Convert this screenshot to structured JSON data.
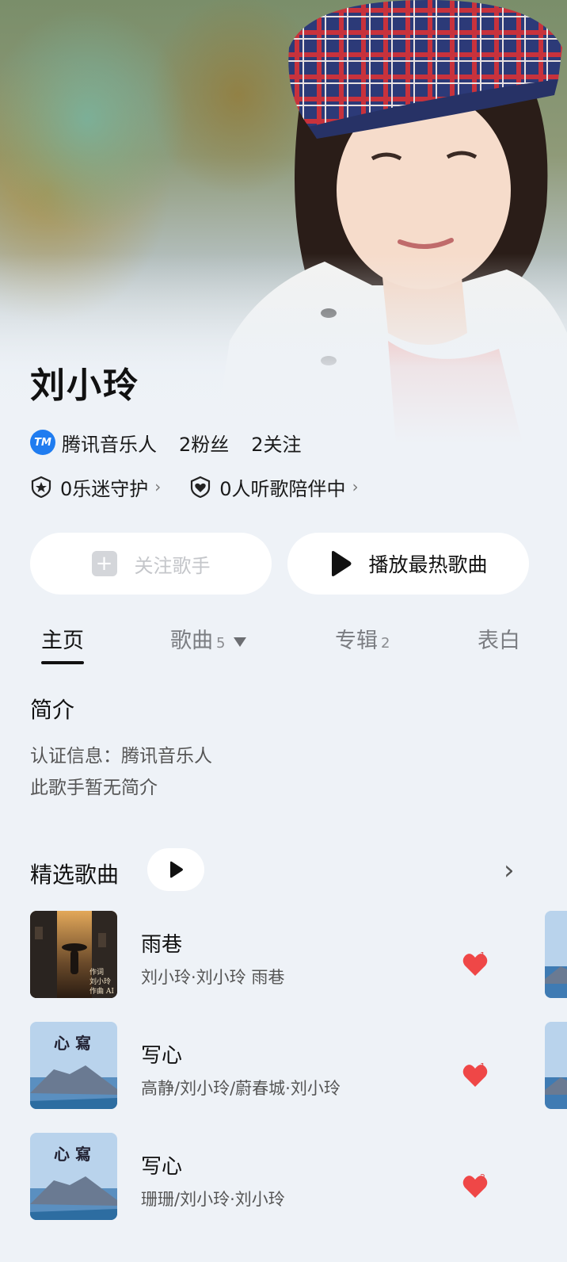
{
  "artist": {
    "name": "刘小玲",
    "badge_label": "腾讯音乐人",
    "fans": "2粉丝",
    "following": "2关注",
    "guard": "0乐迷守护",
    "companions": "0人听歌陪伴中"
  },
  "actions": {
    "follow_label": "关注歌手",
    "play_label": "播放最热歌曲"
  },
  "tabs": [
    {
      "label": "主页",
      "count": ""
    },
    {
      "label": "歌曲",
      "count": "5"
    },
    {
      "label": "专辑",
      "count": "2"
    },
    {
      "label": "表白",
      "count": ""
    }
  ],
  "intro": {
    "title": "简介",
    "verified": "认证信息：腾讯音乐人",
    "bio": "此歌手暂无简介"
  },
  "featured": {
    "title": "精选歌曲",
    "songs": [
      {
        "title": "雨巷",
        "subtitle": "刘小玲·刘小玲 雨巷",
        "likes": "1",
        "cover_text": "作词\n刘小玲\n作曲 AI"
      },
      {
        "title": "写心",
        "subtitle": "高静/刘小玲/蔚春城·刘小玲",
        "likes": "1",
        "cover_text": "心写"
      },
      {
        "title": "写心",
        "subtitle": "珊珊/刘小玲·刘小玲",
        "likes": "2",
        "cover_text": "心写"
      }
    ]
  },
  "colors": {
    "accent_blue": "#1f7cf0",
    "heart_red": "#ef4747",
    "background": "#eef2f7"
  },
  "icons": [
    "tme-badge-icon",
    "star-shield-icon",
    "heart-shield-icon",
    "chevron-right-icon",
    "plus-icon",
    "play-icon",
    "dropdown-triangle-icon",
    "heart-icon"
  ]
}
